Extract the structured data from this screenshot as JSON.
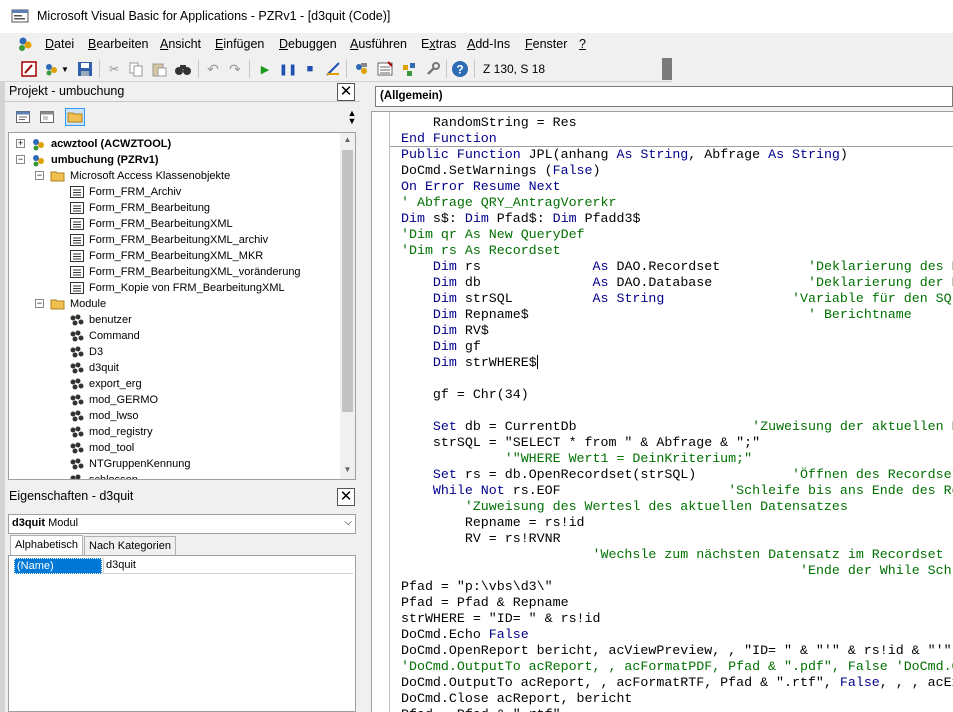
{
  "window": {
    "title": "Microsoft Visual Basic for Applications - PZRv1 - [d3quit (Code)]"
  },
  "menu": [
    {
      "label": "Datei",
      "accel": "D"
    },
    {
      "label": "Bearbeiten",
      "accel": "B"
    },
    {
      "label": "Ansicht",
      "accel": "A"
    },
    {
      "label": "Einfügen",
      "accel": "E"
    },
    {
      "label": "Debuggen",
      "accel": "D"
    },
    {
      "label": "Ausführen",
      "accel": "A"
    },
    {
      "label": "Extras",
      "accel": "x"
    },
    {
      "label": "Add-Ins",
      "accel": "A"
    },
    {
      "label": "Fenster",
      "accel": "F"
    },
    {
      "label": "?",
      "accel": "?"
    }
  ],
  "toolbar": {
    "cursor_position": "Z 130, S 18"
  },
  "project": {
    "title": "Projekt - umbuchung",
    "tree": [
      {
        "label": "acwztool (ACWZTOOL)",
        "level": 0,
        "kind": "project",
        "bold": true,
        "expander": "+"
      },
      {
        "label": "umbuchung (PZRv1)",
        "level": 0,
        "kind": "project",
        "bold": true,
        "expander": "−"
      },
      {
        "label": "Microsoft Access Klassenobjekte",
        "level": 1,
        "kind": "folder",
        "expander": "−"
      },
      {
        "label": "Form_FRM_Archiv",
        "level": 2,
        "kind": "form"
      },
      {
        "label": "Form_FRM_Bearbeitung",
        "level": 2,
        "kind": "form"
      },
      {
        "label": "Form_FRM_BearbeitungXML",
        "level": 2,
        "kind": "form"
      },
      {
        "label": "Form_FRM_BearbeitungXML_archiv",
        "level": 2,
        "kind": "form"
      },
      {
        "label": "Form_FRM_BearbeitungXML_MKR",
        "level": 2,
        "kind": "form"
      },
      {
        "label": "Form_FRM_BearbeitungXML_voränderung",
        "level": 2,
        "kind": "form"
      },
      {
        "label": "Form_Kopie von FRM_BearbeitungXML",
        "level": 2,
        "kind": "form"
      },
      {
        "label": "Module",
        "level": 1,
        "kind": "folder",
        "expander": "−"
      },
      {
        "label": "benutzer",
        "level": 2,
        "kind": "module"
      },
      {
        "label": "Command",
        "level": 2,
        "kind": "module"
      },
      {
        "label": "D3",
        "level": 2,
        "kind": "module"
      },
      {
        "label": "d3quit",
        "level": 2,
        "kind": "module"
      },
      {
        "label": "export_erg",
        "level": 2,
        "kind": "module"
      },
      {
        "label": "mod_GERMO",
        "level": 2,
        "kind": "module"
      },
      {
        "label": "mod_lwso",
        "level": 2,
        "kind": "module"
      },
      {
        "label": "mod_registry",
        "level": 2,
        "kind": "module"
      },
      {
        "label": "mod_tool",
        "level": 2,
        "kind": "module"
      },
      {
        "label": "NTGruppenKennung",
        "level": 2,
        "kind": "module"
      },
      {
        "label": "schlossen",
        "level": 2,
        "kind": "module"
      }
    ]
  },
  "properties": {
    "title": "Eigenschaften - d3quit",
    "object_name": "d3quit",
    "object_type": "Modul",
    "tabs": [
      "Alphabetisch",
      "Nach Kategorien"
    ],
    "row_name": "(Name)",
    "row_value": "d3quit"
  },
  "code": {
    "object_combo": "(Allgemein)",
    "lines": [
      [
        [
          "t",
          "    RandomString = Res"
        ]
      ],
      [
        [
          "k",
          "End Function"
        ]
      ],
      [
        [
          "k",
          "Public Function"
        ],
        [
          "t",
          " JPL(anhang "
        ],
        [
          "k",
          "As String"
        ],
        [
          "t",
          ", Abfrage "
        ],
        [
          "k",
          "As String"
        ],
        [
          "t",
          ")"
        ]
      ],
      [
        [
          "t",
          "DoCmd.SetWarnings ("
        ],
        [
          "k",
          "False"
        ],
        [
          "t",
          ")"
        ]
      ],
      [
        [
          "k",
          "On Error Resume Next"
        ]
      ],
      [
        [
          "c",
          "' Abfrage QRY_AntragVorerkr"
        ]
      ],
      [
        [
          "k",
          "Dim"
        ],
        [
          "t",
          " s$: "
        ],
        [
          "k",
          "Dim"
        ],
        [
          "t",
          " Pfad$: "
        ],
        [
          "k",
          "Dim"
        ],
        [
          "t",
          " Pfadd3$"
        ]
      ],
      [
        [
          "c",
          "'Dim qr As New QueryDef"
        ]
      ],
      [
        [
          "c",
          "'Dim rs As Recordset"
        ]
      ],
      [
        [
          "t",
          "    "
        ],
        [
          "k",
          "Dim"
        ],
        [
          "t",
          " rs              "
        ],
        [
          "k",
          "As"
        ],
        [
          "t",
          " DAO.Recordset           "
        ],
        [
          "c",
          "'Deklarierung des Recordsets"
        ]
      ],
      [
        [
          "t",
          "    "
        ],
        [
          "k",
          "Dim"
        ],
        [
          "t",
          " db              "
        ],
        [
          "k",
          "As"
        ],
        [
          "t",
          " DAO.Database            "
        ],
        [
          "c",
          "'Deklarierung der Datenbank"
        ]
      ],
      [
        [
          "t",
          "    "
        ],
        [
          "k",
          "Dim"
        ],
        [
          "t",
          " strSQL          "
        ],
        [
          "k",
          "As String"
        ],
        [
          "t",
          "                "
        ],
        [
          "c",
          "'Variable für den SQL-String"
        ]
      ],
      [
        [
          "t",
          "    "
        ],
        [
          "k",
          "Dim"
        ],
        [
          "t",
          " Repname$                                   "
        ],
        [
          "c",
          "' Berichtname"
        ]
      ],
      [
        [
          "t",
          "    "
        ],
        [
          "k",
          "Dim"
        ],
        [
          "t",
          " RV$"
        ]
      ],
      [
        [
          "t",
          "    "
        ],
        [
          "k",
          "Dim"
        ],
        [
          "t",
          " gf"
        ]
      ],
      [
        [
          "t",
          "    "
        ],
        [
          "k",
          "Dim"
        ],
        [
          "t",
          " strWHERE$"
        ],
        [
          "caret",
          ""
        ]
      ],
      [
        [
          "t",
          ""
        ]
      ],
      [
        [
          "t",
          "    gf = Chr(34)"
        ]
      ],
      [
        [
          "t",
          ""
        ]
      ],
      [
        [
          "t",
          "    "
        ],
        [
          "k",
          "Set"
        ],
        [
          "t",
          " db = CurrentDb                      "
        ],
        [
          "c",
          "'Zuweisung der aktuellen Datenbank"
        ]
      ],
      [
        [
          "t",
          "    strSQL = \"SELECT * from \" & Abfrage & \";\""
        ]
      ],
      [
        [
          "t",
          "             "
        ],
        [
          "c",
          "'\"WHERE Wert1 = DeinKriterium;\""
        ]
      ],
      [
        [
          "t",
          "    "
        ],
        [
          "k",
          "Set"
        ],
        [
          "t",
          " rs = db.OpenRecordset(strSQL)            "
        ],
        [
          "c",
          "'Öffnen des Recordsets"
        ]
      ],
      [
        [
          "t",
          "    "
        ],
        [
          "k",
          "While Not"
        ],
        [
          "t",
          " rs.EOF                     "
        ],
        [
          "c",
          "'Schleife bis ans Ende des Recordsets"
        ]
      ],
      [
        [
          "t",
          "        "
        ],
        [
          "c",
          "'Zuweisung des Wertesl des aktuellen Datensatzes"
        ]
      ],
      [
        [
          "t",
          "        Repname = rs!id"
        ]
      ],
      [
        [
          "t",
          "        RV = rs!RVNR"
        ]
      ],
      [
        [
          "t",
          "                        "
        ],
        [
          "c",
          "'Wechsle zum nächsten Datensatz im Recordset"
        ]
      ],
      [
        [
          "t",
          "                                                  "
        ],
        [
          "c",
          "'Ende der While Schleife"
        ]
      ],
      [
        [
          "t",
          "Pfad = \"p:\\vbs\\d3\\\""
        ]
      ],
      [
        [
          "t",
          "Pfad = Pfad & Repname"
        ]
      ],
      [
        [
          "t",
          "strWHERE = \"ID= \" & rs!id"
        ]
      ],
      [
        [
          "t",
          "DoCmd.Echo "
        ],
        [
          "k",
          "False"
        ]
      ],
      [
        [
          "t",
          "DoCmd.OpenReport bericht, acViewPreview, , \"ID= \" & \"'\" & rs!id & \"'\""
        ]
      ],
      [
        [
          "c",
          "'DoCmd.OutputTo acReport, , acFormatPDF, Pfad & \".pdf\", False 'DoCmd.OutputTo"
        ]
      ],
      [
        [
          "t",
          "DoCmd.OutputTo acReport, , acFormatRTF, Pfad & \".rtf\", "
        ],
        [
          "k",
          "False"
        ],
        [
          "t",
          ", , , acExport"
        ]
      ],
      [
        [
          "t",
          "DoCmd.Close acReport, bericht"
        ]
      ],
      [
        [
          "t",
          "Pfad = Pfad & \".rtf\""
        ]
      ]
    ]
  },
  "colors": {
    "keyword": "#00008b",
    "comment": "#007000",
    "selection": "#0078d7"
  }
}
